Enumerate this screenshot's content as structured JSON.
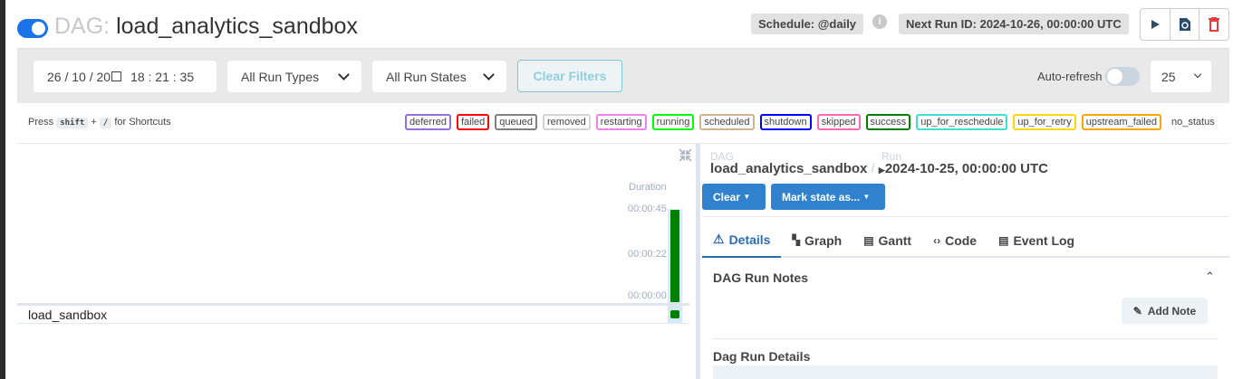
{
  "header": {
    "dag_prefix": "DAG:",
    "dag_id": "load_analytics_sandbox",
    "schedule": "Schedule: @daily",
    "info_icon": "i",
    "next_run": "Next Run ID: 2024-10-26, 00:00:00 UTC"
  },
  "filters": {
    "date": "26 / 10 / 20",
    "time": "18 : 21 : 35",
    "run_types": "All Run Types",
    "run_states": "All Run States",
    "clear_filters": "Clear Filters",
    "auto_refresh": "Auto-refresh",
    "page_size": "25"
  },
  "shortcuts": {
    "press": "Press",
    "shift": "shift",
    "plus": "+",
    "slash": "/",
    "for": "for Shortcuts"
  },
  "legend": [
    {
      "label": "deferred",
      "color": "#9370db"
    },
    {
      "label": "failed",
      "color": "#ff0000"
    },
    {
      "label": "queued",
      "color": "#808080"
    },
    {
      "label": "removed",
      "color": "#d3d3d3"
    },
    {
      "label": "restarting",
      "color": "#ee82ee"
    },
    {
      "label": "running",
      "color": "#00ff00"
    },
    {
      "label": "scheduled",
      "color": "#d2b48c"
    },
    {
      "label": "shutdown",
      "color": "#0000ff"
    },
    {
      "label": "skipped",
      "color": "#ff69b4"
    },
    {
      "label": "success",
      "color": "#008000"
    },
    {
      "label": "up_for_reschedule",
      "color": "#40e0d0"
    },
    {
      "label": "up_for_retry",
      "color": "#ffd700"
    },
    {
      "label": "upstream_failed",
      "color": "#ffa500"
    },
    {
      "label": "no_status",
      "color": ""
    }
  ],
  "grid": {
    "duration_label": "Duration",
    "ticks": [
      "00:00:45",
      "00:00:22",
      "00:00:00"
    ],
    "task": "load_sandbox",
    "run_duration_fraction": 1.0
  },
  "details": {
    "dag_label": "DAG",
    "dag_id": "load_analytics_sandbox",
    "sep": "/",
    "run_label": "Run",
    "run_id": "2024-10-25, 00:00:00 UTC",
    "clear": "Clear",
    "mark_state": "Mark state as...",
    "tabs": [
      "Details",
      "Graph",
      "Gantt",
      "Code",
      "Event Log"
    ],
    "notes_title": "DAG Run Notes",
    "add_note": "Add Note",
    "run_details_title": "Dag Run Details"
  }
}
